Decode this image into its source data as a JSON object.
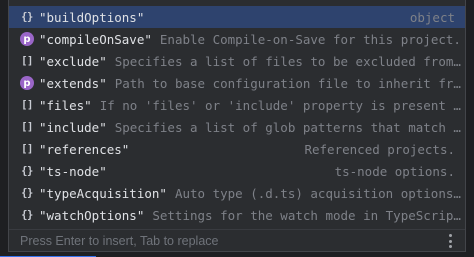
{
  "completion": {
    "items": [
      {
        "icon": "object-icon",
        "glyph": "{}",
        "name": "\"buildOptions\"",
        "desc": "",
        "type": "object",
        "selected": true
      },
      {
        "icon": "property-icon",
        "glyph": "p",
        "name": "\"compileOnSave\"",
        "desc": "Enable Compile-on-Save for this project.",
        "type": ""
      },
      {
        "icon": "array-icon",
        "glyph": "[]",
        "name": "\"exclude\"",
        "desc": "Specifies a list of files to be excluded from…",
        "type": ""
      },
      {
        "icon": "property-icon",
        "glyph": "p",
        "name": "\"extends\"",
        "desc": "Path to base configuration file to inherit fr…",
        "type": ""
      },
      {
        "icon": "array-icon",
        "glyph": "[]",
        "name": "\"files\"",
        "desc": "If no 'files' or 'include' property is present …",
        "type": ""
      },
      {
        "icon": "array-icon",
        "glyph": "[]",
        "name": "\"include\"",
        "desc": "Specifies a list of glob patterns that match …",
        "type": ""
      },
      {
        "icon": "array-icon",
        "glyph": "[]",
        "name": "\"references\"",
        "desc": "Referenced projects.",
        "type": "",
        "right": true
      },
      {
        "icon": "object-icon",
        "glyph": "{}",
        "name": "\"ts-node\"",
        "desc": "ts-node options.",
        "type": "",
        "right": true
      },
      {
        "icon": "object-icon",
        "glyph": "{}",
        "name": "\"typeAcquisition\"",
        "desc": "Auto type (.d.ts) acquisition options…",
        "type": ""
      },
      {
        "icon": "object-icon",
        "glyph": "{}",
        "name": "\"watchOptions\"",
        "desc": "Settings for the watch mode in TypeScrip…",
        "type": ""
      }
    ],
    "footer_hint": "Press Enter to insert, Tab to replace",
    "more_icon": "vertical-dots-icon"
  },
  "colors": {
    "popup_bg": "#2b2d30",
    "selected_bg": "#2e436e",
    "name_text": "#dfe1e5",
    "desc_text": "#7e8188",
    "property_icon_bg": "#9a66c8"
  }
}
